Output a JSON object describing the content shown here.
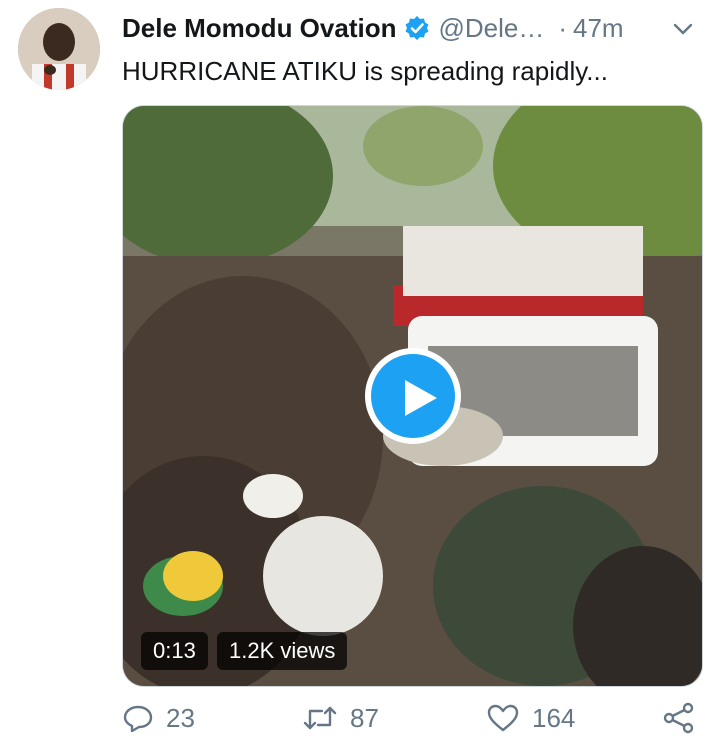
{
  "tweet": {
    "display_name": "Dele Momodu Ovation",
    "handle": "@Dele…",
    "separator": "·",
    "time": "47m",
    "text": "HURRICANE ATIKU is spreading rapidly...",
    "verified_color": "#1da1f2"
  },
  "media": {
    "duration": "0:13",
    "views": "1.2K views"
  },
  "actions": {
    "replies": "23",
    "retweets": "87",
    "likes": "164"
  },
  "icons": [
    "verified-badge-icon",
    "chevron-down-icon",
    "play-icon",
    "reply-icon",
    "retweet-icon",
    "like-icon",
    "share-icon"
  ],
  "colors": {
    "accent": "#1da1f2",
    "muted": "#657786",
    "text": "#14171a"
  }
}
